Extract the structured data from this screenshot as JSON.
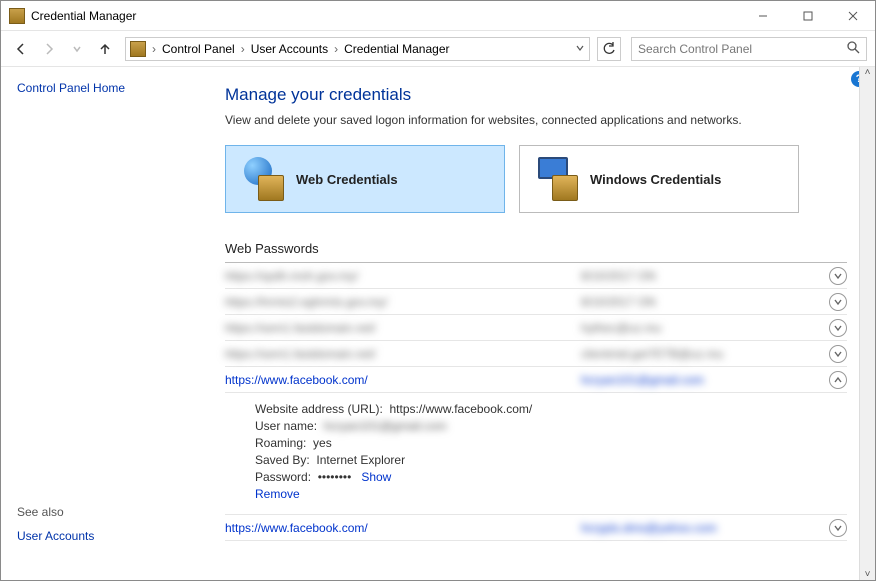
{
  "window": {
    "title": "Credential Manager"
  },
  "nav": {
    "breadcrumb": [
      "Control Panel",
      "User Accounts",
      "Credential Manager"
    ],
    "search_placeholder": "Search Control Panel"
  },
  "sidebar": {
    "home": "Control Panel Home",
    "see_also_label": "See also",
    "see_also_link": "User Accounts"
  },
  "main": {
    "heading": "Manage your credentials",
    "subheading": "View and delete your saved logon information for websites, connected applications and networks.",
    "tabs": {
      "web": "Web Credentials",
      "windows": "Windows Credentials"
    },
    "section_title": "Web Passwords"
  },
  "rows": [
    {
      "site": "https://spdh.moh.gov.my/",
      "modified": "8/10/2017 ON",
      "expanded": false,
      "blurred": true
    },
    {
      "site": "https://hrmis2.eghrmis.gov.my/",
      "modified": "8/10/2017 ON",
      "expanded": false,
      "blurred": true
    },
    {
      "site": "https://sem1.fastdomain.net/",
      "modified": "hythec@uz.mu",
      "expanded": false,
      "blurred": true
    },
    {
      "site": "https://sem1.fastdomain.net/",
      "modified": "clientmid.get7ETB@uz.mu",
      "expanded": false,
      "blurred": true
    },
    {
      "site": "https://www.facebook.com/",
      "modified": "hcryan101@gmail.com",
      "expanded": true,
      "blurred": false
    },
    {
      "site": "https://www.facebook.com/",
      "modified": "hcrypts.dms@yahoo.com",
      "expanded": false,
      "blurred": false
    }
  ],
  "details": {
    "url_label": "Website address (URL):",
    "url_value": "https://www.facebook.com/",
    "user_label": "User name:",
    "user_value": "hcryan101@gmail.com",
    "roaming_label": "Roaming:",
    "roaming_value": "yes",
    "saved_by_label": "Saved By:",
    "saved_by_value": "Internet Explorer",
    "password_label": "Password:",
    "password_mask": "••••••••",
    "show": "Show",
    "remove": "Remove"
  }
}
